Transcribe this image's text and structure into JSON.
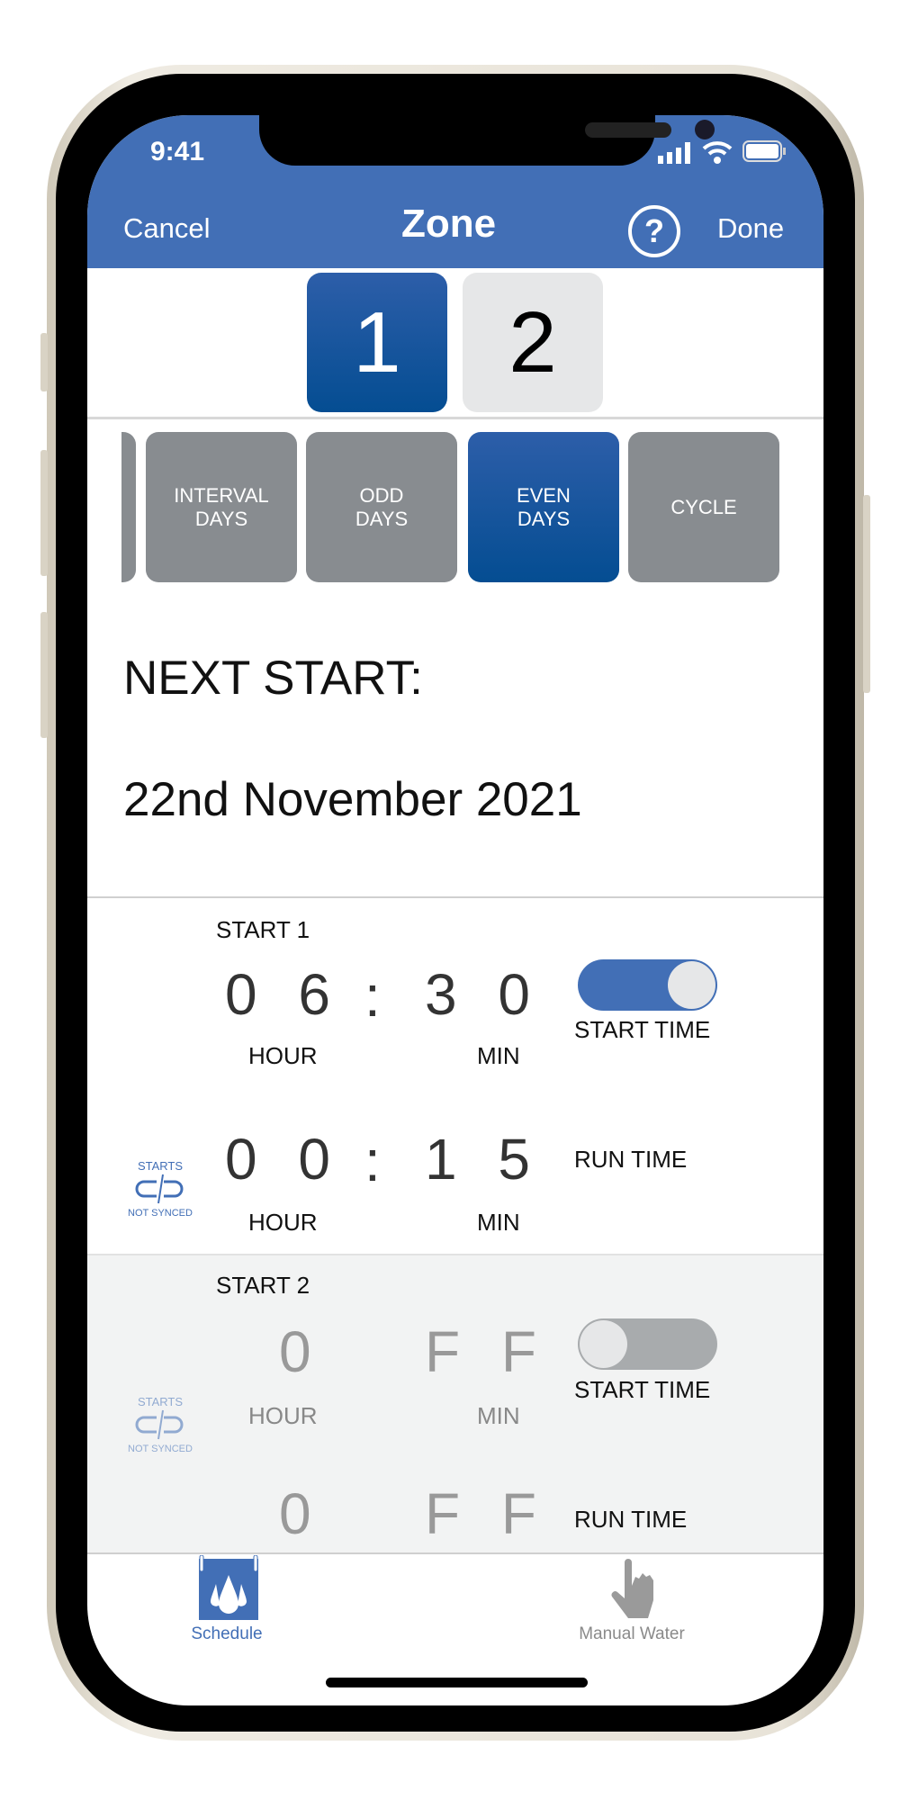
{
  "status_bar": {
    "time": "9:41"
  },
  "header": {
    "cancel": "Cancel",
    "title": "Zone",
    "help_icon": "question-circle-icon",
    "done": "Done"
  },
  "zones": [
    {
      "label": "1",
      "selected": true
    },
    {
      "label": "2",
      "selected": false
    }
  ],
  "programs": [
    {
      "label": "INTERVAL\nDAYS"
    },
    {
      "label": "ODD\nDAYS"
    },
    {
      "label": "EVEN\nDAYS",
      "selected": true
    },
    {
      "label": "CYCLE"
    }
  ],
  "next_start": {
    "label": "NEXT START:",
    "date": "22nd November 2021"
  },
  "starts": [
    {
      "title": "START 1",
      "start_hour": "0 6",
      "start_min": "3 0",
      "toggle_on": true,
      "start_label": "START TIME",
      "run_hour": "0 0",
      "run_min": "1 5",
      "run_label": "RUN TIME",
      "hour_label": "HOUR",
      "min_label": "MIN",
      "sync_top": "STARTS",
      "sync_bottom": "NOT SYNCED",
      "colon": ":"
    },
    {
      "title": "START 2",
      "start_hour": "0",
      "start_min": "F F",
      "toggle_on": false,
      "start_label": "START TIME",
      "run_hour": "0",
      "run_min": "F F",
      "run_label": "RUN TIME",
      "hour_label": "HOUR",
      "min_label": "MIN",
      "sync_top": "STARTS",
      "sync_bottom": "NOT SYNCED"
    }
  ],
  "tabs": [
    {
      "label": "Schedule",
      "icon": "water-drops-calendar-icon",
      "active": true
    },
    {
      "label": "Manual Water",
      "icon": "hand-pointer-icon",
      "active": false
    }
  ],
  "colors": {
    "accent": "#426fb6",
    "selected": "#044d92",
    "inactive": "#888c90"
  }
}
